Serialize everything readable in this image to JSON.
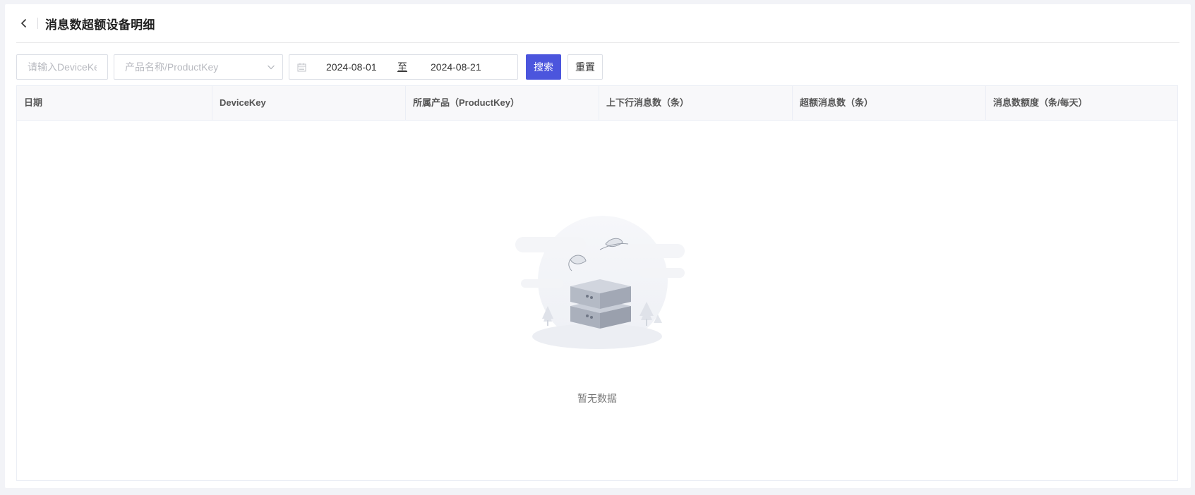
{
  "header": {
    "title": "消息数超额设备明细"
  },
  "filters": {
    "device_key_placeholder": "请输入DeviceKey",
    "product_placeholder": "产品名称/ProductKey",
    "date_start": "2024-08-01",
    "date_sep": "至",
    "date_end": "2024-08-21",
    "search_label": "搜索",
    "reset_label": "重置"
  },
  "table": {
    "columns": [
      "日期",
      "DeviceKey",
      "所属产品（ProductKey）",
      "上下行消息数（条）",
      "超额消息数（条）",
      "消息数额度（条/每天）"
    ],
    "rows": [],
    "empty_text": "暂无数据"
  },
  "colors": {
    "primary": "#4b55dd",
    "page_bg": "#f2f3f7"
  },
  "icons": [
    "chevron-left-icon",
    "calendar-icon",
    "chevron-down-icon",
    "empty-data-illustration"
  ]
}
